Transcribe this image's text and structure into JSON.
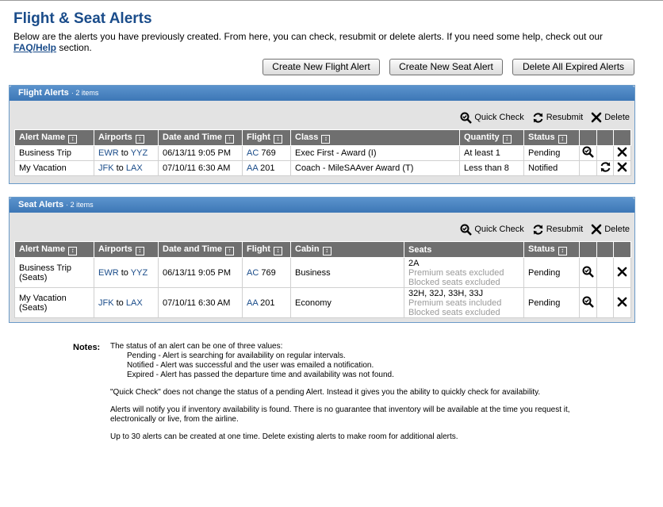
{
  "page": {
    "title": "Flight & Seat Alerts",
    "intro_text": "Below are the alerts you have previously created. From here, you can check, resubmit or delete alerts. If you need some help, check out our",
    "faq_link": "FAQ/Help",
    "intro_suffix": "section."
  },
  "buttons": {
    "create_flight": "Create New Flight Alert",
    "create_seat": "Create New Seat Alert",
    "delete_expired": "Delete All Expired Alerts"
  },
  "actions": {
    "quick_check": "Quick Check",
    "resubmit": "Resubmit",
    "delete": "Delete"
  },
  "flight_alerts": {
    "title": "Flight Alerts",
    "count": "2 items",
    "columns": [
      "Alert Name",
      "Airports",
      "Date and Time",
      "Flight",
      "Class",
      "Quantity",
      "Status"
    ],
    "rows": [
      {
        "name": "Business Trip",
        "from": "EWR",
        "to_word": "to",
        "to": "YYZ",
        "datetime": "06/13/11 9:05 PM",
        "airline": "AC",
        "flight_no": "769",
        "class": "Exec First - Award (I)",
        "quantity": "At least 1",
        "status": "Pending",
        "icons": [
          "quick-check",
          "delete"
        ]
      },
      {
        "name": "My Vacation",
        "from": "JFK",
        "to_word": "to",
        "to": "LAX",
        "datetime": "07/10/11 6:30 AM",
        "airline": "AA",
        "flight_no": "201",
        "class": "Coach - MileSAAver Award (T)",
        "quantity": "Less than 8",
        "status": "Notified",
        "icons": [
          "resubmit",
          "delete"
        ]
      }
    ]
  },
  "seat_alerts": {
    "title": "Seat Alerts",
    "count": "2 items",
    "columns": [
      "Alert Name",
      "Airports",
      "Date and Time",
      "Flight",
      "Cabin",
      "Seats",
      "Status"
    ],
    "rows": [
      {
        "name_line1": "Business Trip",
        "name_line2": "(Seats)",
        "from": "EWR",
        "to_word": "to",
        "to": "YYZ",
        "datetime": "06/13/11 9:05 PM",
        "airline": "AC",
        "flight_no": "769",
        "cabin": "Business",
        "seats": "2A",
        "premium": "Premium seats excluded",
        "blocked": "Blocked seats excluded",
        "status": "Pending"
      },
      {
        "name_line1": "My Vacation",
        "name_line2": "(Seats)",
        "from": "JFK",
        "to_word": "to",
        "to": "LAX",
        "datetime": "07/10/11 6:30 AM",
        "airline": "AA",
        "flight_no": "201",
        "cabin": "Economy",
        "seats": "32H, 32J, 33H, 33J",
        "premium": "Premium seats included",
        "blocked": "Blocked seats excluded",
        "status": "Pending"
      }
    ]
  },
  "notes": {
    "label": "Notes:",
    "status_intro": "The status of an alert can be one of three values:",
    "pending": "Pending - Alert is searching for availability on regular intervals.",
    "notified": "Notified - Alert was successful and the user was emailed a notification.",
    "expired": "Expired - Alert has passed the departure time and availability was not found.",
    "quick_check": "\"Quick Check\" does not change the status of a pending Alert. Instead it gives you the ability to quickly check for availability.",
    "inventory": "Alerts will notify you if inventory availability is found. There is no guarantee that inventory will be available at the time you request it, electronically or live, from the airline.",
    "limit": "Up to 30 alerts can be created at one time. Delete existing alerts to make room for additional alerts."
  },
  "colors": {
    "title": "#1a4c8a",
    "panel_header": "#3d77b6",
    "table_header": "#6f6f6f",
    "link": "#1a4c8a"
  },
  "icons": {
    "quick_check": "magnifier-check-icon",
    "resubmit": "circular-arrows-icon",
    "delete": "x-icon",
    "sort_both": "sort-arrows-icon",
    "sort_up": "sort-up-icon"
  }
}
